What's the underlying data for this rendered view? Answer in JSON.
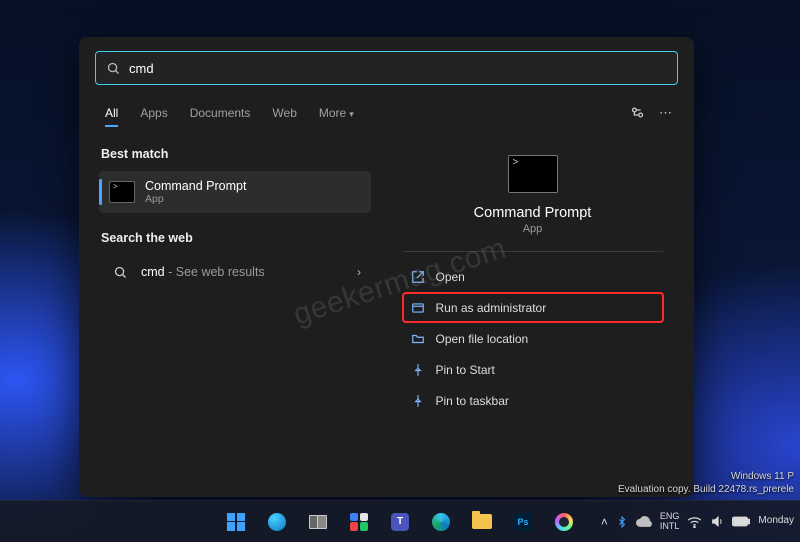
{
  "search": {
    "query": "cmd"
  },
  "tabs": {
    "t0": "All",
    "t1": "Apps",
    "t2": "Documents",
    "t3": "Web",
    "t4": "More"
  },
  "left": {
    "best_match_heading": "Best match",
    "result_title": "Command Prompt",
    "result_sub": "App",
    "web_heading": "Search the web",
    "web_term": "cmd",
    "web_hint": " - See web results"
  },
  "right": {
    "title": "Command Prompt",
    "sub": "App",
    "actions": {
      "a0": "Open",
      "a1": "Run as administrator",
      "a2": "Open file location",
      "a3": "Pin to Start",
      "a4": "Pin to taskbar"
    }
  },
  "watermark": "geekermag.com",
  "desktop_wm": {
    "l1": "Windows 11 P",
    "l2": "Evaluation copy. Build 22478.rs_prerele"
  },
  "taskbar": {
    "lang1": "ENG",
    "lang2": "INTL",
    "clock": "Monday"
  }
}
